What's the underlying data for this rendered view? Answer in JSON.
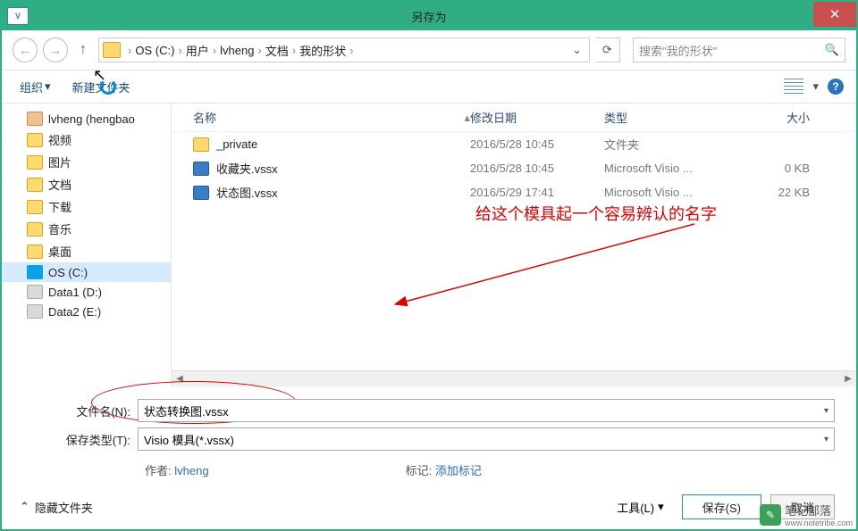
{
  "titlebar": {
    "title": "另存为",
    "app": "V"
  },
  "nav": {
    "crumbs": [
      "OS (C:)",
      "用户",
      "lvheng",
      "文档",
      "我的形状"
    ],
    "search_placeholder": "搜索\"我的形状\""
  },
  "toolbar": {
    "organize": "组织",
    "newfolder": "新建文件夹"
  },
  "sidebar": {
    "items": [
      {
        "label": "lvheng (hengbao",
        "icon": "user"
      },
      {
        "label": "视频",
        "icon": "folder"
      },
      {
        "label": "图片",
        "icon": "folder"
      },
      {
        "label": "文档",
        "icon": "folder"
      },
      {
        "label": "下载",
        "icon": "folder"
      },
      {
        "label": "音乐",
        "icon": "folder"
      },
      {
        "label": "桌面",
        "icon": "folder"
      },
      {
        "label": "OS (C:)",
        "icon": "win",
        "selected": true
      },
      {
        "label": "Data1 (D:)",
        "icon": "drive"
      },
      {
        "label": "Data2 (E:)",
        "icon": "drive"
      }
    ]
  },
  "filelist": {
    "headers": {
      "name": "名称",
      "date": "修改日期",
      "type": "类型",
      "size": "大小"
    },
    "rows": [
      {
        "name": "_private",
        "date": "2016/5/28 10:45",
        "type": "文件夹",
        "size": "",
        "icon": "folder"
      },
      {
        "name": "收藏夹.vssx",
        "date": "2016/5/28 10:45",
        "type": "Microsoft Visio ...",
        "size": "0 KB",
        "icon": "vssx"
      },
      {
        "name": "状态图.vssx",
        "date": "2016/5/29 17:41",
        "type": "Microsoft Visio ...",
        "size": "22 KB",
        "icon": "vssx"
      }
    ]
  },
  "annotation": "给这个模具起一个容易辨认的名字",
  "form": {
    "filename_label": "文件名(N):",
    "filename_value": "状态转换图.vssx",
    "savetype_label": "保存类型(T):",
    "savetype_value": "Visio 模具(*.vssx)",
    "author_label": "作者:",
    "author_value": "lvheng",
    "tags_label": "标记:",
    "tags_value": "添加标记"
  },
  "footer": {
    "hide": "隐藏文件夹",
    "tools": "工具(L)",
    "save": "保存(S)",
    "cancel": "取消",
    "logo": "笔记部落",
    "logo_sub": "www.notetribe.com"
  }
}
